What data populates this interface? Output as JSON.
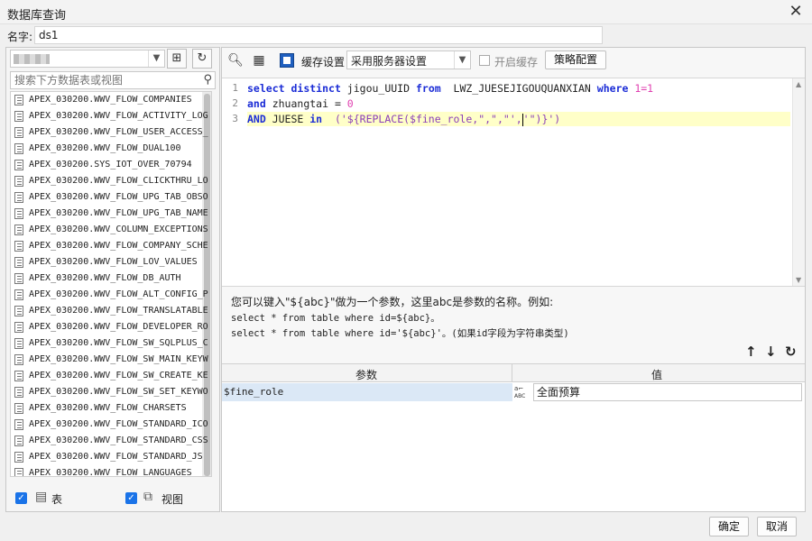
{
  "window": {
    "title": "数据库查询"
  },
  "name": {
    "label": "名字:",
    "value": "ds1"
  },
  "left": {
    "search_placeholder": "搜索下方数据表或视图",
    "tables": [
      "APEX_030200.WWV_FLOW_COMPANIES",
      "APEX_030200.WWV_FLOW_ACTIVITY_LOG",
      "APEX_030200.WWV_FLOW_USER_ACCESS_",
      "APEX_030200.WWV_FLOW_DUAL100",
      "APEX_030200.SYS_IOT_OVER_70794",
      "APEX_030200.WWV_FLOW_CLICKTHRU_LO",
      "APEX_030200.WWV_FLOW_UPG_TAB_OBSO",
      "APEX_030200.WWV_FLOW_UPG_TAB_NAME",
      "APEX_030200.WWV_COLUMN_EXCEPTIONS",
      "APEX_030200.WWV_FLOW_COMPANY_SCHE",
      "APEX_030200.WWV_FLOW_LOV_VALUES",
      "APEX_030200.WWV_FLOW_DB_AUTH",
      "APEX_030200.WWV_FLOW_ALT_CONFIG_P",
      "APEX_030200.WWV_FLOW_TRANSLATABLE",
      "APEX_030200.WWV_FLOW_DEVELOPER_RO",
      "APEX_030200.WWV_FLOW_SW_SQLPLUS_C",
      "APEX_030200.WWV_FLOW_SW_MAIN_KEYW",
      "APEX_030200.WWV_FLOW_SW_CREATE_KE",
      "APEX_030200.WWV_FLOW_SW_SET_KEYWO",
      "APEX_030200.WWV_FLOW_CHARSETS",
      "APEX_030200.WWV_FLOW_STANDARD_ICO",
      "APEX_030200.WWV_FLOW_STANDARD_CSS",
      "APEX_030200.WWV_FLOW_STANDARD_JS",
      "APEX_030200.WWV_FLOW_LANGUAGES"
    ],
    "filter_table_label": "表",
    "filter_view_label": "视图"
  },
  "toolbar": {
    "cache_settings_label": "缓存设置",
    "cache_mode": "采用服务器设置",
    "enable_cache_label": "开启缓存",
    "strategy_label": "策略配置"
  },
  "editor": {
    "line_numbers": [
      "1",
      "2",
      "3"
    ],
    "lines": [
      [
        {
          "t": "select",
          "c": "kw"
        },
        {
          "t": " ",
          "c": ""
        },
        {
          "t": "distinct",
          "c": "kw"
        },
        {
          "t": " jigou_UUID ",
          "c": ""
        },
        {
          "t": "from",
          "c": "kw"
        },
        {
          "t": "  LWZ_JUESEJIGOUQUANXIAN ",
          "c": ""
        },
        {
          "t": "where",
          "c": "kw"
        },
        {
          "t": " ",
          "c": ""
        },
        {
          "t": "1=1",
          "c": "num"
        }
      ],
      [
        {
          "t": "and",
          "c": "kw"
        },
        {
          "t": " zhuangtai = ",
          "c": ""
        },
        {
          "t": "0",
          "c": "num"
        }
      ],
      [
        {
          "t": "AND",
          "c": "kw"
        },
        {
          "t": " JUESE ",
          "c": ""
        },
        {
          "t": "in",
          "c": "kw"
        },
        {
          "t": "  ('${REPLACE($fine_role,\",\",\"',",
          "c": "str"
        },
        {
          "t": "'\")}')",
          "c": "str"
        }
      ]
    ]
  },
  "hint": {
    "line1": "您可以键入\"${abc}\"做为一个参数，这里abc是参数的名称。例如:",
    "line2": "select * from table where id=${abc}。",
    "line3": "select * from table where id='${abc}'。(如果id字段为字符串类型)"
  },
  "params": {
    "header_param": "参数",
    "header_value": "值",
    "rows": [
      {
        "name": "$fine_role",
        "type_icon": "ABC",
        "value": "全面预算"
      }
    ]
  },
  "footer": {
    "ok_label": "确定",
    "cancel_label": "取消"
  }
}
